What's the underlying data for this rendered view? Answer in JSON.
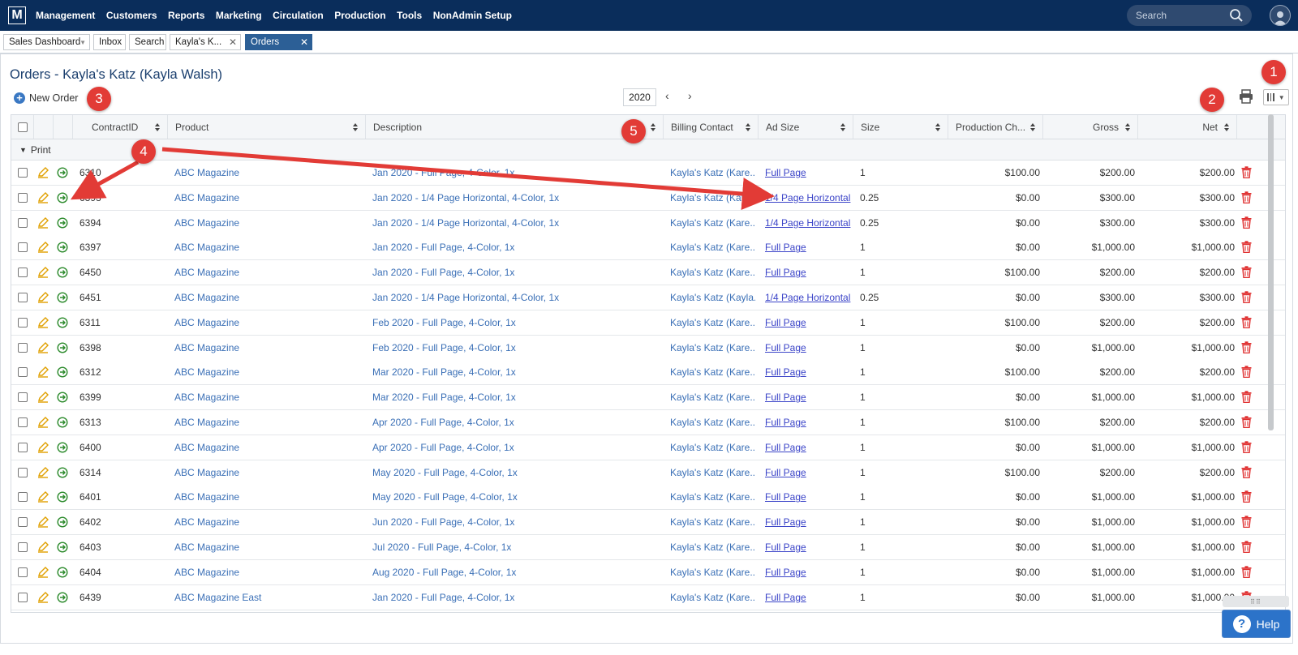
{
  "app": {
    "logo": "M",
    "nav": [
      "Management",
      "Customers",
      "Reports",
      "Marketing",
      "Circulation",
      "Production",
      "Tools",
      "NonAdmin Setup"
    ],
    "search_placeholder": "Search"
  },
  "tabs": [
    {
      "label": "Sales Dashboard",
      "dropdown": true
    },
    {
      "label": "Inbox"
    },
    {
      "label": "Search"
    },
    {
      "label": "Kayla's K...",
      "closable": true
    },
    {
      "label": "Orders",
      "closable": true,
      "active": true
    }
  ],
  "page": {
    "title": "Orders - Kayla's Katz (Kayla Walsh)",
    "new_order": "New Order",
    "year": "2020",
    "prev": "‹",
    "next": "›"
  },
  "grid": {
    "columns": [
      "ContractID",
      "Product",
      "Description",
      "Billing Contact",
      "Ad Size",
      "Size",
      "Production Ch...",
      "Gross",
      "Net"
    ],
    "group": "Print",
    "rows": [
      {
        "id": "6310",
        "product": "ABC Magazine",
        "desc": "Jan 2020 - Full Page, 4-Color, 1x",
        "contact": "Kayla's Katz (Kare...",
        "adsize": "Full Page",
        "size": "1",
        "prod": "$100.00",
        "gross": "$200.00",
        "net": "$200.00"
      },
      {
        "id": "6393",
        "product": "ABC Magazine",
        "desc": "Jan 2020 - 1/4 Page Horizontal, 4-Color, 1x",
        "contact": "Kayla's Katz (Kare...",
        "adsize": "1/4 Page Horizontal",
        "size": "0.25",
        "prod": "$0.00",
        "gross": "$300.00",
        "net": "$300.00"
      },
      {
        "id": "6394",
        "product": "ABC Magazine",
        "desc": "Jan 2020 - 1/4 Page Horizontal, 4-Color, 1x",
        "contact": "Kayla's Katz (Kare...",
        "adsize": "1/4 Page Horizontal",
        "size": "0.25",
        "prod": "$0.00",
        "gross": "$300.00",
        "net": "$300.00"
      },
      {
        "id": "6397",
        "product": "ABC Magazine",
        "desc": "Jan 2020 - Full Page, 4-Color, 1x",
        "contact": "Kayla's Katz (Kare...",
        "adsize": "Full Page",
        "size": "1",
        "prod": "$0.00",
        "gross": "$1,000.00",
        "net": "$1,000.00"
      },
      {
        "id": "6450",
        "product": "ABC Magazine",
        "desc": "Jan 2020 - Full Page, 4-Color, 1x",
        "contact": "Kayla's Katz (Kare...",
        "adsize": "Full Page",
        "size": "1",
        "prod": "$100.00",
        "gross": "$200.00",
        "net": "$200.00"
      },
      {
        "id": "6451",
        "product": "ABC Magazine",
        "desc": "Jan 2020 - 1/4 Page Horizontal, 4-Color, 1x",
        "contact": "Kayla's Katz (Kayla...",
        "adsize": "1/4 Page Horizontal",
        "size": "0.25",
        "prod": "$0.00",
        "gross": "$300.00",
        "net": "$300.00"
      },
      {
        "id": "6311",
        "product": "ABC Magazine",
        "desc": "Feb 2020 - Full Page, 4-Color, 1x",
        "contact": "Kayla's Katz (Kare...",
        "adsize": "Full Page",
        "size": "1",
        "prod": "$100.00",
        "gross": "$200.00",
        "net": "$200.00"
      },
      {
        "id": "6398",
        "product": "ABC Magazine",
        "desc": "Feb 2020 - Full Page, 4-Color, 1x",
        "contact": "Kayla's Katz (Kare...",
        "adsize": "Full Page",
        "size": "1",
        "prod": "$0.00",
        "gross": "$1,000.00",
        "net": "$1,000.00"
      },
      {
        "id": "6312",
        "product": "ABC Magazine",
        "desc": "Mar 2020 - Full Page, 4-Color, 1x",
        "contact": "Kayla's Katz (Kare...",
        "adsize": "Full Page",
        "size": "1",
        "prod": "$100.00",
        "gross": "$200.00",
        "net": "$200.00"
      },
      {
        "id": "6399",
        "product": "ABC Magazine",
        "desc": "Mar 2020 - Full Page, 4-Color, 1x",
        "contact": "Kayla's Katz (Kare...",
        "adsize": "Full Page",
        "size": "1",
        "prod": "$0.00",
        "gross": "$1,000.00",
        "net": "$1,000.00"
      },
      {
        "id": "6313",
        "product": "ABC Magazine",
        "desc": "Apr 2020 - Full Page, 4-Color, 1x",
        "contact": "Kayla's Katz (Kare...",
        "adsize": "Full Page",
        "size": "1",
        "prod": "$100.00",
        "gross": "$200.00",
        "net": "$200.00"
      },
      {
        "id": "6400",
        "product": "ABC Magazine",
        "desc": "Apr 2020 - Full Page, 4-Color, 1x",
        "contact": "Kayla's Katz (Kare...",
        "adsize": "Full Page",
        "size": "1",
        "prod": "$0.00",
        "gross": "$1,000.00",
        "net": "$1,000.00"
      },
      {
        "id": "6314",
        "product": "ABC Magazine",
        "desc": "May 2020 - Full Page, 4-Color, 1x",
        "contact": "Kayla's Katz (Kare...",
        "adsize": "Full Page",
        "size": "1",
        "prod": "$100.00",
        "gross": "$200.00",
        "net": "$200.00"
      },
      {
        "id": "6401",
        "product": "ABC Magazine",
        "desc": "May 2020 - Full Page, 4-Color, 1x",
        "contact": "Kayla's Katz (Kare...",
        "adsize": "Full Page",
        "size": "1",
        "prod": "$0.00",
        "gross": "$1,000.00",
        "net": "$1,000.00"
      },
      {
        "id": "6402",
        "product": "ABC Magazine",
        "desc": "Jun 2020 - Full Page, 4-Color, 1x",
        "contact": "Kayla's Katz (Kare...",
        "adsize": "Full Page",
        "size": "1",
        "prod": "$0.00",
        "gross": "$1,000.00",
        "net": "$1,000.00"
      },
      {
        "id": "6403",
        "product": "ABC Magazine",
        "desc": "Jul 2020 - Full Page, 4-Color, 1x",
        "contact": "Kayla's Katz (Kare...",
        "adsize": "Full Page",
        "size": "1",
        "prod": "$0.00",
        "gross": "$1,000.00",
        "net": "$1,000.00"
      },
      {
        "id": "6404",
        "product": "ABC Magazine",
        "desc": "Aug 2020 - Full Page, 4-Color, 1x",
        "contact": "Kayla's Katz (Kare...",
        "adsize": "Full Page",
        "size": "1",
        "prod": "$0.00",
        "gross": "$1,000.00",
        "net": "$1,000.00"
      },
      {
        "id": "6439",
        "product": "ABC Magazine East",
        "desc": "Jan 2020 - Full Page, 4-Color, 1x",
        "contact": "Kayla's Katz (Kare...",
        "adsize": "Full Page",
        "size": "1",
        "prod": "$0.00",
        "gross": "$1,000.00",
        "net": "$1,000.00"
      }
    ]
  },
  "callouts": [
    "1",
    "2",
    "3",
    "4",
    "5"
  ],
  "help": {
    "label": "Help",
    "q": "?"
  },
  "colors": {
    "nav_bg": "#0a2d5b",
    "link": "#3a6fb6",
    "adsize_link": "#3b44c8",
    "callout": "#e23b36",
    "edit_icon": "#e0a000",
    "go_icon": "#2b8a2b",
    "trash": "#e03030",
    "help_bg": "#2c73c9"
  },
  "icons": [
    "search-icon",
    "user-icon",
    "plus-icon",
    "print-icon",
    "columns-icon",
    "edit-icon",
    "go-icon",
    "trash-icon",
    "help-icon"
  ]
}
